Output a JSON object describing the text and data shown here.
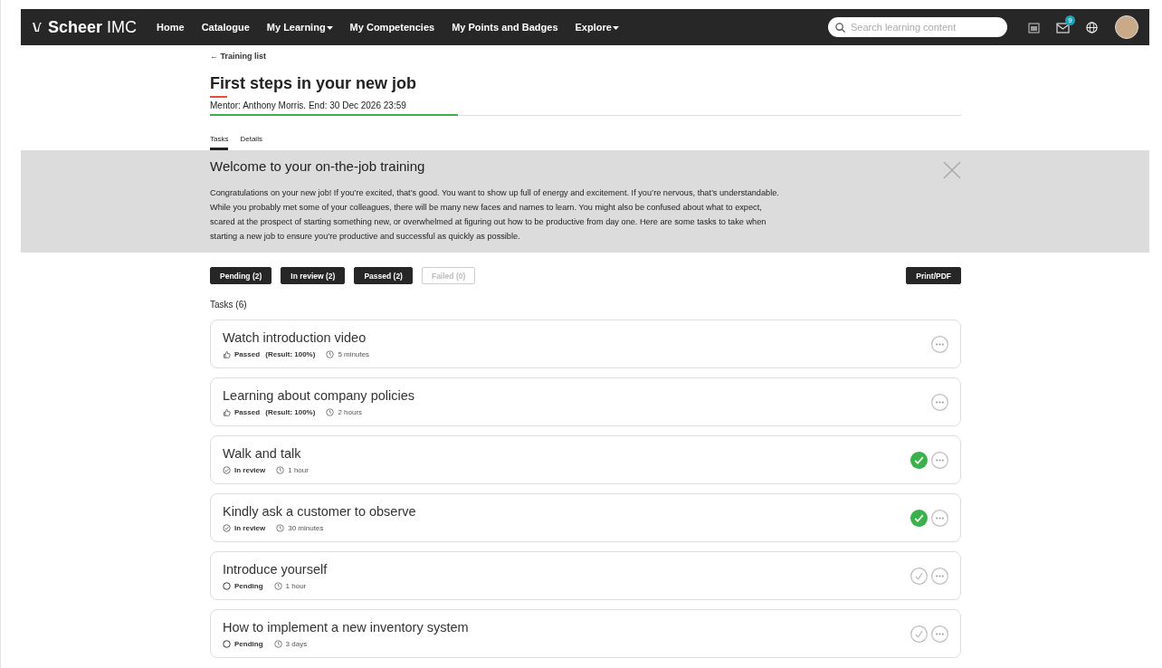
{
  "nav": {
    "logo_bold": "Scheer",
    "logo_light": "IMC",
    "items": [
      {
        "label": "Home",
        "dropdown": false
      },
      {
        "label": "Catalogue",
        "dropdown": false
      },
      {
        "label": "My Learning",
        "dropdown": true
      },
      {
        "label": "My Competencies",
        "dropdown": false
      },
      {
        "label": "My Points and Badges",
        "dropdown": false
      },
      {
        "label": "Explore",
        "dropdown": true
      }
    ],
    "search": {
      "placeholder": "Search learning content"
    },
    "messages_badge": "9"
  },
  "back_link": "← Training list",
  "title": "First steps in your new job",
  "subtitle": "Mentor: Anthony Morris. End: 30 Dec 2026 23:59",
  "progress": {
    "level": 0.33
  },
  "tabs": [
    {
      "label": "Tasks",
      "selected": true
    },
    {
      "label": "Details",
      "selected": false
    }
  ],
  "banner": {
    "title": "Welcome to your on-the-job training",
    "text": "Congratulations on your new job! If you’re excited, that’s good. You want to show up full of energy and excitement. If you’re nervous, that’s understandable. While you probably met some of your colleagues, there will be many new faces and names to learn. You might also be confused about what to expect, scared at the prospect of starting something new, or overwhelmed at figuring out how to be productive from day one. Here are some tasks to take when starting a new job to ensure you’re productive and successful as quickly as possible."
  },
  "filters": [
    {
      "label": "Pending (2)",
      "disabled": false
    },
    {
      "label": "In review (2)",
      "disabled": false
    },
    {
      "label": "Passed (2)",
      "disabled": false
    },
    {
      "label": "Failed (0)",
      "disabled": true
    }
  ],
  "print_button": "Print/PDF",
  "tasks_heading": "Tasks (6)",
  "tasks": [
    {
      "title": "Watch introduction video",
      "kind": "passed",
      "status": "Passed",
      "result": "(Result: 100%)",
      "duration": "5 minutes"
    },
    {
      "title": "Learning about company policies",
      "kind": "passed",
      "status": "Passed",
      "result": "(Result: 100%)",
      "duration": "2 hours"
    },
    {
      "title": "Walk and talk",
      "kind": "review",
      "status": "In review",
      "duration": "1 hour"
    },
    {
      "title": "Kindly ask a customer to observe",
      "kind": "review",
      "status": "In review",
      "duration": "30 minutes"
    },
    {
      "title": "Introduce yourself",
      "kind": "pending",
      "status": "Pending",
      "duration": "1 hour"
    },
    {
      "title": "How to implement a new inventory system",
      "kind": "pending",
      "status": "Pending",
      "duration": "3 days"
    }
  ]
}
